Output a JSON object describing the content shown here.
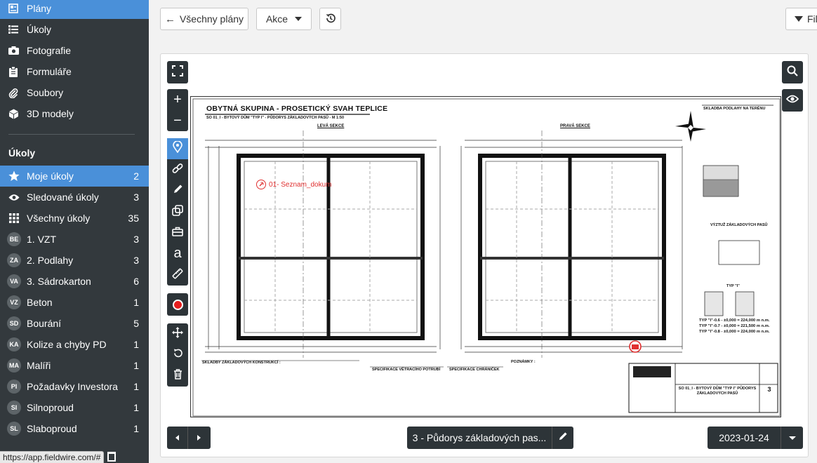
{
  "sidebar": {
    "nav": [
      {
        "label": "Plány",
        "icon": "plans-icon"
      },
      {
        "label": "Úkoly",
        "icon": "list-icon"
      },
      {
        "label": "Fotografie",
        "icon": "camera-icon"
      },
      {
        "label": "Formuláře",
        "icon": "clipboard-icon"
      },
      {
        "label": "Soubory",
        "icon": "paperclip-icon"
      },
      {
        "label": "3D modely",
        "icon": "cube-icon"
      }
    ],
    "tasks_title": "Úkoly",
    "tasks": [
      {
        "label": "Moje úkoly",
        "count": "2",
        "icon": "star-icon"
      },
      {
        "label": "Sledované úkoly",
        "count": "3",
        "icon": "eye-icon"
      },
      {
        "label": "Všechny úkoly",
        "count": "35",
        "icon": "grid-icon"
      },
      {
        "abbr": "BE",
        "label": "1. VZT",
        "count": "3"
      },
      {
        "abbr": "ZA",
        "label": "2. Podlahy",
        "count": "3"
      },
      {
        "abbr": "VA",
        "label": "3. Sádrokarton",
        "count": "6"
      },
      {
        "abbr": "VZ",
        "label": "Beton",
        "count": "1"
      },
      {
        "abbr": "SD",
        "label": "Bourání",
        "count": "5"
      },
      {
        "abbr": "KA",
        "label": "Kolize a chyby PD",
        "count": "1"
      },
      {
        "abbr": "MA",
        "label": "Malíři",
        "count": "1"
      },
      {
        "abbr": "PI",
        "label": "Požadavky Investora",
        "count": "1"
      },
      {
        "abbr": "SI",
        "label": "Silnoproud",
        "count": "1"
      },
      {
        "abbr": "SL",
        "label": "Slaboproud",
        "count": "1"
      }
    ],
    "status_url": "https://app.fieldwire.com/#"
  },
  "toolbar": {
    "back_label": "Všechny plány",
    "actions_label": "Akce",
    "filter_label": "Fil"
  },
  "drawing": {
    "title": "OBYTNÁ SKUPINA - PROSETICKÝ SVAH TEPLICE",
    "subtitle": "SO 01_I - BYTOVÝ DŮM \"TYP I\" - PŮDORYS ZÁKLADOVÝCH PASŮ - M 1:50",
    "left_section": "LEVÁ SEKCE",
    "right_section": "PRAVÁ SEKCE",
    "link_label": "01- Seznam_dokum",
    "right_title": "SKLADBA PODLAHY NA TERÉNU",
    "rebar_title": "VÝZTUŽ ZÁKLADOVÝCH PASŮ",
    "type_label": "TYP \"I\"",
    "stamp_title": "SO 01_I - BYTOVÝ DŮM \"TYP I\" PŮDORYS ZÁKLADOVÝCH PASŮ",
    "sheet_no": "3",
    "notes": [
      "SKLADBY ZÁKLADOVÝCH KONSTRUKCÍ :",
      "SPECIFIKACE VĚTRACÍHO POTRUBÍ",
      "SPECIFIKACE CHRÁNIČEK",
      "POZNÁMKY :"
    ],
    "levels": [
      "TYP \"I\"-0.6 - ±0,000 = 224,000 m n.m.",
      "TYP \"I\"-0.7 - ±0,000 = 221,500 m n.m.",
      "TYP \"I\"-0.8 - ±0,000 = 224,000 m n.m."
    ]
  },
  "footer": {
    "sheet_name": "3 - Půdorys základových pas...",
    "date": "2023-01-24"
  }
}
